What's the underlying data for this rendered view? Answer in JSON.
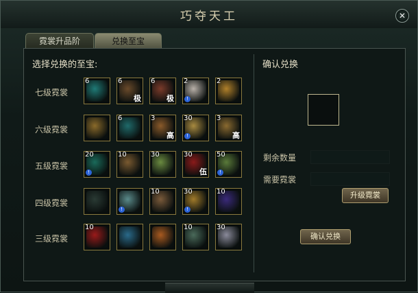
{
  "title": "巧夺天工",
  "close_label": "✕",
  "tabs": [
    {
      "label": "霓裳升品阶",
      "active": false
    },
    {
      "label": "兑换至宝",
      "active": true
    }
  ],
  "left_label": "选择兑换的至宝:",
  "right_label": "确认兑换",
  "rows": [
    {
      "label": "七级霓裳",
      "items": [
        {
          "count": "6",
          "badge": "",
          "warn": false,
          "icon": "teal-vase-icon",
          "color": "#1f7a76"
        },
        {
          "count": "6",
          "badge": "极",
          "warn": false,
          "icon": "scroll-blue-icon",
          "color": "#6a4a2a"
        },
        {
          "count": "6",
          "badge": "极",
          "warn": false,
          "icon": "scroll-red-icon",
          "color": "#7a3a2a"
        },
        {
          "count": "2",
          "badge": "",
          "warn": true,
          "icon": "white-chest-icon",
          "color": "#b8b0a8"
        },
        {
          "count": "2",
          "badge": "",
          "warn": false,
          "icon": "golden-scroll-icon",
          "color": "#b0802a"
        }
      ]
    },
    {
      "label": "六级霓裳",
      "items": [
        {
          "count": "",
          "badge": "",
          "warn": false,
          "icon": "turtle-shell-icon",
          "color": "#8a6a2a"
        },
        {
          "count": "6",
          "badge": "",
          "warn": false,
          "icon": "teal-vase-icon",
          "color": "#1f6a6a"
        },
        {
          "count": "3",
          "badge": "高",
          "warn": false,
          "icon": "scroll-orange-icon",
          "color": "#8a5a2a"
        },
        {
          "count": "30",
          "badge": "",
          "warn": true,
          "icon": "golden-fan-icon",
          "color": "#a88a40"
        },
        {
          "count": "3",
          "badge": "高",
          "warn": false,
          "icon": "scroll-gold-icon",
          "color": "#8a6a30"
        }
      ]
    },
    {
      "label": "五级霓裳",
      "items": [
        {
          "count": "20",
          "badge": "",
          "warn": true,
          "icon": "jade-mound-icon",
          "color": "#1a6a5a"
        },
        {
          "count": "10",
          "badge": "",
          "warn": false,
          "icon": "bronze-scroll-icon",
          "color": "#7a5a30"
        },
        {
          "count": "30",
          "badge": "",
          "warn": false,
          "icon": "glowing-orb-icon",
          "color": "#6a8a40"
        },
        {
          "count": "30",
          "badge": "伍",
          "warn": false,
          "icon": "red-lantern-icon",
          "color": "#8a1a1a"
        },
        {
          "count": "50",
          "badge": "",
          "warn": true,
          "icon": "green-orb-icon",
          "color": "#5a7a3a"
        }
      ]
    },
    {
      "label": "四级霓裳",
      "items": [
        {
          "count": "",
          "badge": "",
          "warn": false,
          "icon": "dark-stone-icon",
          "color": "#2a3a34"
        },
        {
          "count": "",
          "badge": "",
          "warn": true,
          "icon": "porcelain-vase-icon",
          "color": "#5a8a8a"
        },
        {
          "count": "10",
          "badge": "",
          "warn": false,
          "icon": "bronze-statue-icon",
          "color": "#7a5a3a"
        },
        {
          "count": "30",
          "badge": "",
          "warn": true,
          "icon": "golden-crystal-ball-icon",
          "color": "#a07a2a"
        },
        {
          "count": "10",
          "badge": "",
          "warn": false,
          "icon": "purple-chest-icon",
          "color": "#3a2a7a"
        }
      ]
    },
    {
      "label": "三级霓裳",
      "items": [
        {
          "count": "10",
          "badge": "",
          "warn": false,
          "icon": "red-pouch-icon",
          "color": "#9a1a1a"
        },
        {
          "count": "",
          "badge": "",
          "warn": false,
          "icon": "globe-icon",
          "color": "#2a6a8a"
        },
        {
          "count": "",
          "badge": "",
          "warn": false,
          "icon": "flame-swirl-icon",
          "color": "#a85a20"
        },
        {
          "count": "10",
          "badge": "",
          "warn": false,
          "icon": "buddha-statue-icon",
          "color": "#4a6a5a"
        },
        {
          "count": "30",
          "badge": "",
          "warn": false,
          "icon": "white-vase-icon",
          "color": "#8a8a9a"
        }
      ]
    }
  ],
  "info": {
    "remaining_label": "剩余数量",
    "remaining_value": "",
    "needed_label": "需要霓裳",
    "needed_value": ""
  },
  "upgrade_button": "升级霓裳",
  "confirm_button": "确认兑换",
  "colors": {
    "slot_border": "#8b7a3e",
    "text": "#c8c2a6"
  }
}
